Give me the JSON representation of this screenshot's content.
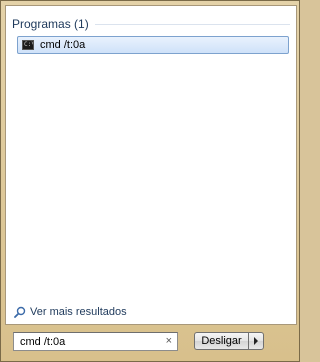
{
  "results": {
    "section_title": "Programas (1)",
    "items": [
      {
        "label": "cmd /t:0a",
        "icon": "cmd-icon",
        "icon_text": "C:\\"
      }
    ]
  },
  "more_results": {
    "label": "Ver mais resultados",
    "icon": "magnifier-icon"
  },
  "search": {
    "value": "cmd /t:0a",
    "clear_icon": "×"
  },
  "power": {
    "shutdown_label": "Desligar",
    "arrow_icon": "chevron-right-icon"
  },
  "colors": {
    "frame": "#d8c49a",
    "header_text": "#1e395b",
    "selection_border": "#7da2ce"
  }
}
